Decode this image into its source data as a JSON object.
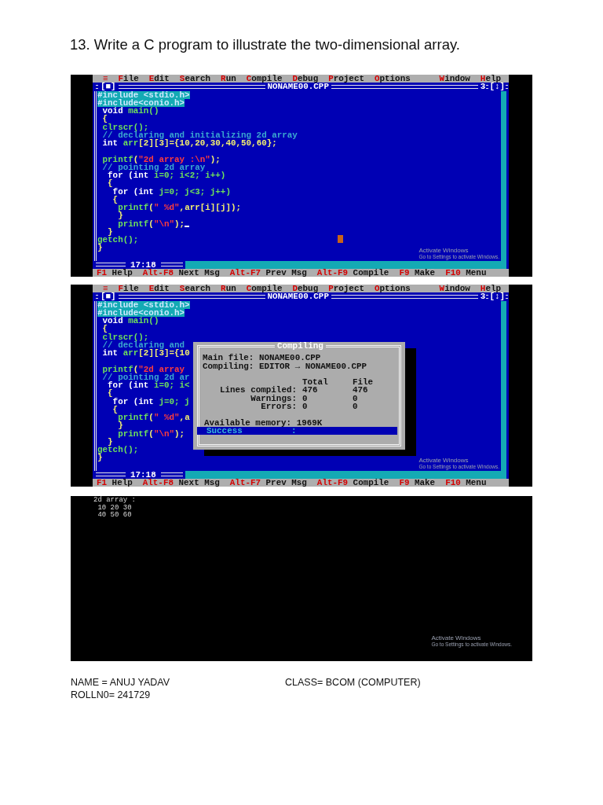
{
  "heading": "13. Write a C program to illustrate the two-dimensional array.",
  "screens": [
    {
      "kind": "editor",
      "mouse_pointer": true,
      "menu": {
        "left": [
          "≡",
          "File",
          "Edit",
          "Search",
          "Run",
          "Compile",
          "Debug",
          "Project",
          "Options"
        ],
        "right": [
          "Window",
          "Help"
        ]
      },
      "close_box": "[■]",
      "title": "NONAME00.CPP",
      "window_number": "3",
      "zoom_box": "[↕]",
      "code": [
        {
          "selected": true,
          "tokens": [
            {
              "kind": "id",
              "text": "#include <stdio.h>"
            }
          ]
        },
        {
          "selected": true,
          "tokens": [
            {
              "kind": "id",
              "text": "#include<conio.h>"
            }
          ]
        },
        {
          "selected": false,
          "tokens": [
            {
              "kind": "kw",
              "text": " void"
            },
            {
              "kind": "id",
              "text": " main()"
            }
          ]
        },
        {
          "selected": false,
          "tokens": [
            {
              "kind": "sym",
              "text": " {"
            }
          ]
        },
        {
          "selected": false,
          "tokens": [
            {
              "kind": "id",
              "text": " clrscr();"
            }
          ]
        },
        {
          "selected": false,
          "tokens": [
            {
              "kind": "cmt",
              "text": " // declaring and initializing 2d array"
            }
          ]
        },
        {
          "selected": false,
          "tokens": [
            {
              "kind": "kw",
              "text": " int"
            },
            {
              "kind": "id",
              "text": " arr"
            },
            {
              "kind": "sym",
              "text": "[2][3]={10,20,30,40,50,60};"
            }
          ]
        },
        {
          "kind": "blank"
        },
        {
          "selected": false,
          "tokens": [
            {
              "kind": "id",
              "text": " printf"
            },
            {
              "kind": "sym",
              "text": "("
            },
            {
              "kind": "str",
              "text": "\"2d array :\\n\""
            },
            {
              "kind": "sym",
              "text": ");"
            }
          ]
        },
        {
          "selected": false,
          "tokens": [
            {
              "kind": "cmt",
              "text": " // pointing 2d array"
            }
          ]
        },
        {
          "selected": false,
          "tokens": [
            {
              "kind": "kw",
              "text": "  for (int"
            },
            {
              "kind": "id",
              "text": " i=0; i<2; i++)"
            }
          ]
        },
        {
          "selected": false,
          "tokens": [
            {
              "kind": "sym",
              "text": "  {"
            }
          ]
        },
        {
          "selected": false,
          "tokens": [
            {
              "kind": "kw",
              "text": "   for (int"
            },
            {
              "kind": "id",
              "text": " j=0; j<3; j++)"
            }
          ]
        },
        {
          "selected": false,
          "tokens": [
            {
              "kind": "sym",
              "text": "   {"
            }
          ]
        },
        {
          "selected": false,
          "tokens": [
            {
              "kind": "id",
              "text": "    printf"
            },
            {
              "kind": "sym",
              "text": "("
            },
            {
              "kind": "str",
              "text": "\" %d\""
            },
            {
              "kind": "sym",
              "text": ",arr[i][j]);"
            }
          ]
        },
        {
          "selected": false,
          "tokens": [
            {
              "kind": "sym",
              "text": "    }"
            }
          ]
        },
        {
          "selected": false,
          "cursor": true,
          "tokens": [
            {
              "kind": "id",
              "text": "    printf"
            },
            {
              "kind": "sym",
              "text": "("
            },
            {
              "kind": "str",
              "text": "\"\\n\""
            },
            {
              "kind": "sym",
              "text": ");"
            }
          ]
        },
        {
          "selected": false,
          "tokens": [
            {
              "kind": "sym",
              "text": "  }"
            }
          ]
        },
        {
          "selected": false,
          "tokens": [
            {
              "kind": "id",
              "text": "getch();"
            }
          ]
        },
        {
          "selected": false,
          "tokens": [
            {
              "kind": "sym",
              "text": "}"
            }
          ]
        }
      ],
      "position": "17:18",
      "watermark": {
        "title": "Activate Windows",
        "subtitle": "Go to Settings to activate Windows."
      },
      "function_keys": [
        {
          "key": "F1",
          "label": "Help"
        },
        {
          "key": "Alt-F8",
          "label": "Next Msg"
        },
        {
          "key": "Alt-F7",
          "label": "Prev Msg"
        },
        {
          "key": "Alt-F9",
          "label": "Compile"
        },
        {
          "key": "F9",
          "label": "Make"
        },
        {
          "key": "F10",
          "label": "Menu"
        }
      ]
    },
    {
      "kind": "editor",
      "menu": {
        "left": [
          "≡",
          "File",
          "Edit",
          "Search",
          "Run",
          "Compile",
          "Debug",
          "Project",
          "Options"
        ],
        "right": [
          "Window",
          "Help"
        ]
      },
      "close_box": "[■]",
      "title": "NONAME00.CPP",
      "window_number": "3",
      "zoom_box": "[↕]",
      "code": [
        {
          "selected": true,
          "tokens": [
            {
              "kind": "id",
              "text": "#include <stdio.h>"
            }
          ]
        },
        {
          "selected": true,
          "tokens": [
            {
              "kind": "id",
              "text": "#include<conio.h>"
            }
          ]
        },
        {
          "selected": false,
          "tokens": [
            {
              "kind": "kw",
              "text": " void"
            },
            {
              "kind": "id",
              "text": " main()"
            }
          ]
        },
        {
          "selected": false,
          "tokens": [
            {
              "kind": "sym",
              "text": " {"
            }
          ]
        },
        {
          "selected": false,
          "tokens": [
            {
              "kind": "id",
              "text": " clrscr();"
            }
          ]
        },
        {
          "selected": false,
          "tokens": [
            {
              "kind": "cmt",
              "text": " // declaring and"
            }
          ]
        },
        {
          "selected": false,
          "tokens": [
            {
              "kind": "kw",
              "text": " int"
            },
            {
              "kind": "id",
              "text": " arr"
            },
            {
              "kind": "sym",
              "text": "[2][3]={10"
            }
          ]
        },
        {
          "kind": "blank"
        },
        {
          "selected": false,
          "tokens": [
            {
              "kind": "id",
              "text": " printf"
            },
            {
              "kind": "sym",
              "text": "("
            },
            {
              "kind": "str",
              "text": "\"2d array"
            }
          ]
        },
        {
          "selected": false,
          "tokens": [
            {
              "kind": "cmt",
              "text": " // pointing 2d ar"
            }
          ]
        },
        {
          "selected": false,
          "tokens": [
            {
              "kind": "kw",
              "text": "  for (int"
            },
            {
              "kind": "id",
              "text": " i=0; i<"
            }
          ]
        },
        {
          "selected": false,
          "tokens": [
            {
              "kind": "sym",
              "text": "  {"
            }
          ]
        },
        {
          "selected": false,
          "tokens": [
            {
              "kind": "kw",
              "text": "   for (int"
            },
            {
              "kind": "id",
              "text": " j=0; j"
            }
          ]
        },
        {
          "selected": false,
          "tokens": [
            {
              "kind": "sym",
              "text": "   {"
            }
          ]
        },
        {
          "selected": false,
          "tokens": [
            {
              "kind": "id",
              "text": "    printf"
            },
            {
              "kind": "sym",
              "text": "("
            },
            {
              "kind": "str",
              "text": "\" %d\""
            },
            {
              "kind": "sym",
              "text": ",a"
            }
          ]
        },
        {
          "selected": false,
          "tokens": [
            {
              "kind": "sym",
              "text": "    }"
            }
          ]
        },
        {
          "selected": false,
          "tokens": [
            {
              "kind": "id",
              "text": "    printf"
            },
            {
              "kind": "sym",
              "text": "("
            },
            {
              "kind": "str",
              "text": "\"\\n\""
            },
            {
              "kind": "sym",
              "text": ");"
            }
          ]
        },
        {
          "selected": false,
          "tokens": [
            {
              "kind": "sym",
              "text": "  }"
            }
          ]
        },
        {
          "selected": false,
          "tokens": [
            {
              "kind": "id",
              "text": "getch();"
            }
          ]
        },
        {
          "selected": false,
          "tokens": [
            {
              "kind": "sym",
              "text": "}"
            }
          ]
        }
      ],
      "dialog": {
        "title": "Compiling",
        "lines": [
          "Main file: NONAME00.CPP",
          "Compiling: EDITOR → NONAME00.CPP"
        ],
        "columns": [
          "Total",
          "File"
        ],
        "rows": [
          {
            "label": "Lines compiled:",
            "total": "476",
            "file": "476"
          },
          {
            "label": "Warnings:",
            "total": "0",
            "file": "0"
          },
          {
            "label": "Errors:",
            "total": "0",
            "file": "0"
          }
        ],
        "memory": "Available memory: 1969K",
        "result": "Success",
        "result_separator": ":"
      },
      "position": "17:18",
      "watermark": {
        "title": "Activate Windows",
        "subtitle": "Go to Settings to activate Windows."
      },
      "function_keys": [
        {
          "key": "F1",
          "label": "Help"
        },
        {
          "key": "Alt-F8",
          "label": "Next Msg"
        },
        {
          "key": "Alt-F7",
          "label": "Prev Msg"
        },
        {
          "key": "Alt-F9",
          "label": "Compile"
        },
        {
          "key": "F9",
          "label": "Make"
        },
        {
          "key": "F10",
          "label": "Menu"
        }
      ]
    },
    {
      "kind": "output",
      "lines": [
        "2d array :",
        " 10 20 30",
        " 40 50 60"
      ],
      "watermark": {
        "title": "Activate Windows",
        "subtitle": "Go to Settings to activate Windows."
      }
    }
  ],
  "footer": {
    "name": "NAME = ANUJ YADAV",
    "class": "CLASS= BCOM (COMPUTER)",
    "roll": "ROLLN0= 241729"
  }
}
